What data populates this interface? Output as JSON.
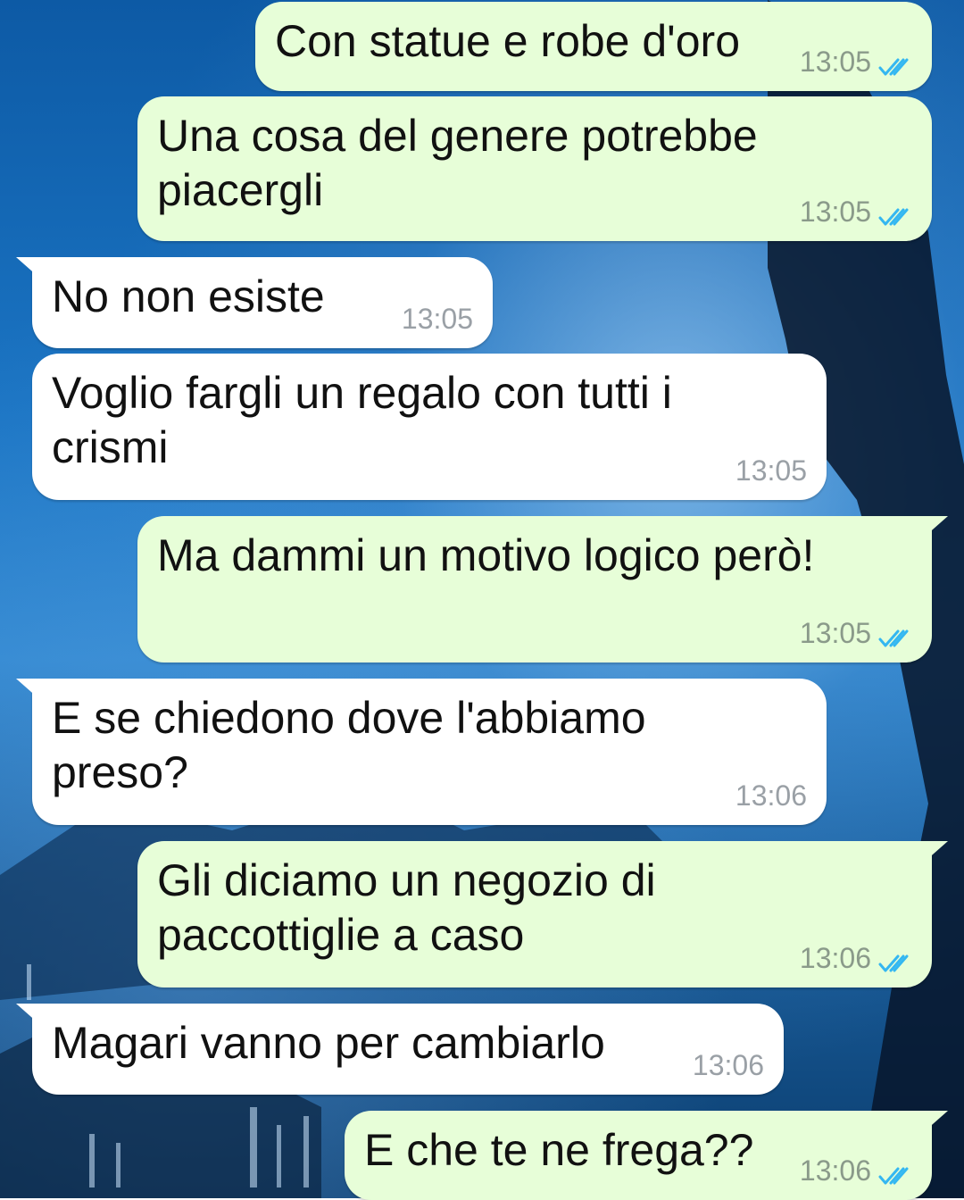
{
  "messages": [
    {
      "dir": "out",
      "text": "Con statue e robe d'oro",
      "time": "13:05",
      "read": true
    },
    {
      "dir": "out",
      "text": "Una cosa del genere potrebbe\npiacergli",
      "time": "13:05",
      "read": true
    },
    {
      "dir": "in",
      "text": "No non esiste",
      "time": "13:05"
    },
    {
      "dir": "in",
      "text": "Voglio fargli un regalo con tutti i\ncrismi",
      "time": "13:05"
    },
    {
      "dir": "out",
      "text": "Ma dammi un motivo logico però!",
      "time": "13:05",
      "read": true
    },
    {
      "dir": "in",
      "text": "E se chiedono dove l'abbiamo\npreso?",
      "time": "13:06"
    },
    {
      "dir": "out",
      "text": "Gli diciamo un negozio di\npaccottiglie a caso",
      "time": "13:06",
      "read": true
    },
    {
      "dir": "in",
      "text": "Magari vanno per cambiarlo",
      "time": "13:06"
    },
    {
      "dir": "out",
      "text": "E che te ne frega??",
      "time": "13:06",
      "read": true
    }
  ],
  "colors": {
    "outgoing": "#e7fed8",
    "incoming": "#ffffff",
    "read_ticks": "#34b7f1"
  },
  "icons": {
    "read_receipt": "double-check-icon"
  }
}
